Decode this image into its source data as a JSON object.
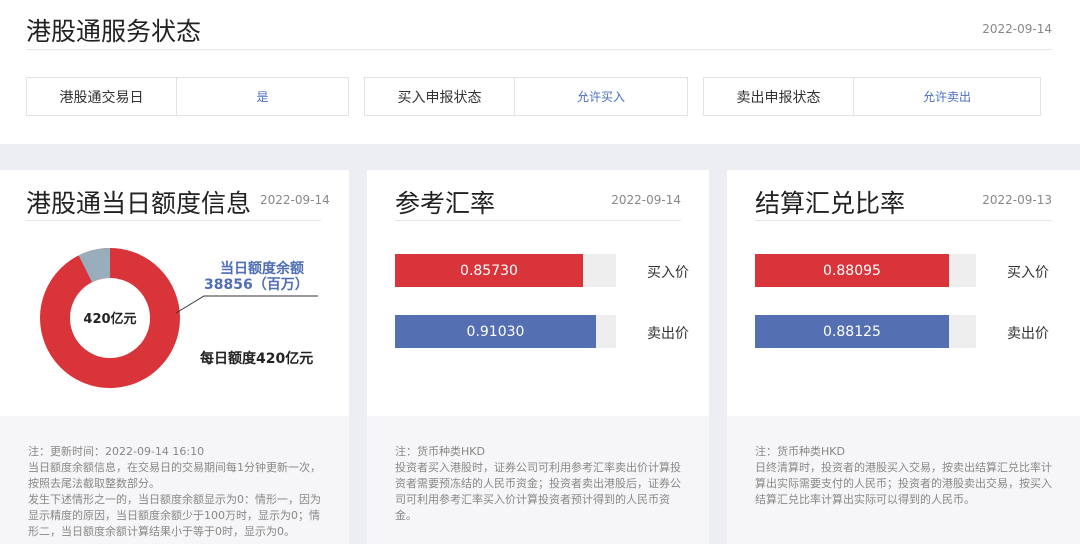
{
  "service": {
    "title": "港股通服务状态",
    "date": "2022-09-14",
    "items": [
      {
        "label": "港股通交易日",
        "value": "是"
      },
      {
        "label": "买入申报状态",
        "value": "允许买入"
      },
      {
        "label": "卖出申报状态",
        "value": "允许卖出"
      }
    ]
  },
  "quota": {
    "title": "港股通当日额度信息",
    "date": "2022-09-14",
    "center_label": "420亿元",
    "remaining_label": "当日额度余额",
    "remaining_value": "38856（百万）",
    "daily_label": "每日额度420亿元",
    "remaining_million": 38856,
    "total_million": 42000,
    "note": [
      "注：更新时间：2022-09-14 16:10",
      "当日额度余额信息，在交易日的交易期间每1分钟更新一次，按照去尾法截取整数部分。",
      "发生下述情形之一的，当日额度余额显示为0：情形一，因为显示精度的原因，当日额度余额少于100万时，显示为0；情形二，当日额度余额计算结果小于等于0时，显示为0。"
    ]
  },
  "ref_rate": {
    "title": "参考汇率",
    "date": "2022-09-14",
    "buy_label": "买入价",
    "buy_value": "0.85730",
    "buy_fraction": 0.85,
    "sell_label": "卖出价",
    "sell_value": "0.91030",
    "sell_fraction": 0.91,
    "note": [
      "注：货币种类HKD",
      "投资者买入港股时，证券公司可利用参考汇率卖出价计算投资者需要预冻结的人民币资金；投资者卖出港股后，证券公司可利用参考汇率买入价计算投资者预计得到的人民币资金。"
    ]
  },
  "settle_rate": {
    "title": "结算汇兑比率",
    "date": "2022-09-13",
    "buy_label": "买入价",
    "buy_value": "0.88095",
    "buy_fraction": 0.88,
    "sell_label": "卖出价",
    "sell_value": "0.88125",
    "sell_fraction": 0.88,
    "note": [
      "注：货币种类HKD",
      "日终清算时，投资者的港股买入交易，按卖出结算汇兑比率计算出实际需要支付的人民币；投资者的港股卖出交易，按买入结算汇兑比率计算出实际可以得到的人民币。"
    ]
  },
  "colors": {
    "red": "#d9343a",
    "blue": "#5470b3",
    "grey": "#98aebd",
    "link": "#4a6ec4"
  }
}
